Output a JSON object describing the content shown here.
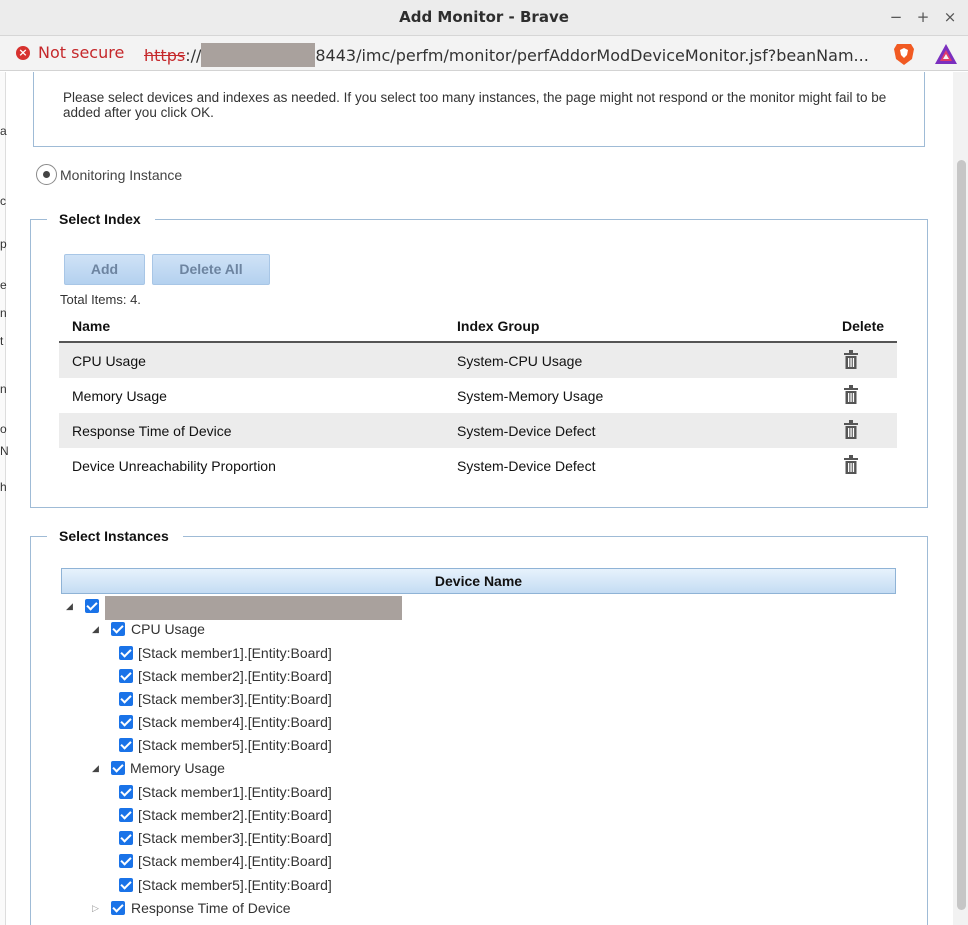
{
  "window": {
    "title": "Add Monitor - Brave",
    "buttons": [
      "−",
      "+",
      "×"
    ]
  },
  "address_bar": {
    "security_label": "Not secure",
    "scheme": "https",
    "scheme_sep": "://",
    "url_rest": "8443/imc/perfm/monitor/perfAddorModDeviceMonitor.jsf?beanNam..."
  },
  "left_strip_chars": [
    "a",
    "c",
    "p",
    "e",
    "n",
    "t",
    "n",
    "o",
    "N",
    "h"
  ],
  "notice": {
    "text": "Please select devices and indexes as needed. If you select too many instances, the page might not respond or the monitor might fail to be added after you click OK."
  },
  "monitoring_instance": {
    "label": "Monitoring Instance"
  },
  "select_index": {
    "legend": "Select Index",
    "add_label": "Add",
    "delete_all_label": "Delete All",
    "total_text": "Total Items: 4.",
    "columns": [
      "Name",
      "Index Group",
      "Delete"
    ],
    "rows": [
      {
        "name": "CPU Usage",
        "group": "System-CPU Usage"
      },
      {
        "name": "Memory Usage",
        "group": "System-Memory Usage"
      },
      {
        "name": "Response Time of Device",
        "group": "System-Device Defect"
      },
      {
        "name": "Device Unreachability Proportion",
        "group": "System-Device Defect"
      }
    ]
  },
  "select_instances": {
    "legend": "Select Instances",
    "column_header": "Device Name",
    "tree": [
      {
        "label": "CPU Usage",
        "children": [
          "[Stack member1].[Entity:Board]",
          "[Stack member2].[Entity:Board]",
          "[Stack member3].[Entity:Board]",
          "[Stack member4].[Entity:Board]",
          "[Stack member5].[Entity:Board]"
        ]
      },
      {
        "label": "Memory Usage",
        "children": [
          "[Stack member1].[Entity:Board]",
          "[Stack member2].[Entity:Board]",
          "[Stack member3].[Entity:Board]",
          "[Stack member4].[Entity:Board]",
          "[Stack member5].[Entity:Board]"
        ]
      },
      {
        "label": "Response Time of Device",
        "children": []
      }
    ]
  },
  "colors": {
    "insecure": "#c5282b",
    "checkbox": "#1a73e8",
    "button_bg": "#b4d1ef",
    "fieldset_border": "#9fbbd6"
  }
}
